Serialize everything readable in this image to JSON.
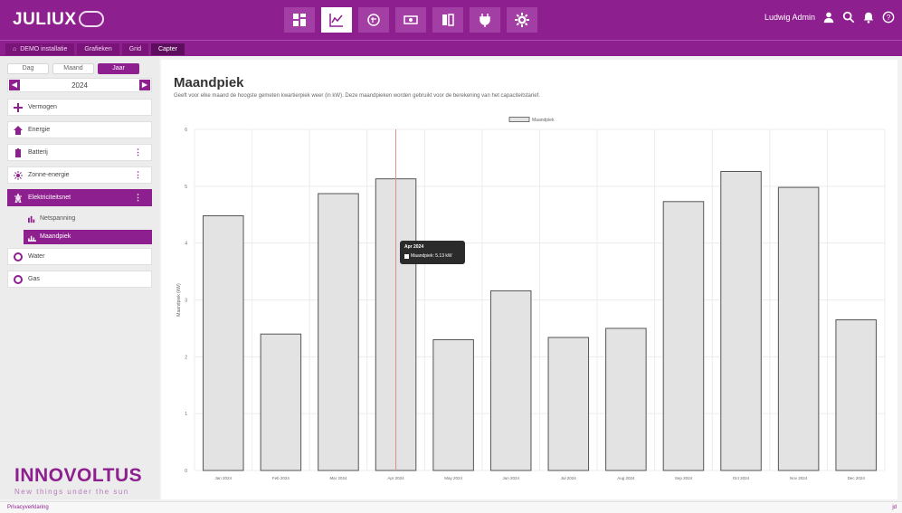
{
  "app": {
    "name": "JULIUX"
  },
  "nav": [
    {
      "name": "dashboard",
      "icon": "dashboard-icon",
      "active": false
    },
    {
      "name": "grafieken",
      "icon": "line-chart-icon",
      "active": true
    },
    {
      "name": "brain",
      "icon": "brain-icon",
      "active": false
    },
    {
      "name": "money",
      "icon": "money-icon",
      "active": false
    },
    {
      "name": "battery",
      "icon": "battery-icon",
      "active": false
    },
    {
      "name": "plug",
      "icon": "plug-icon",
      "active": false
    },
    {
      "name": "settings",
      "icon": "gear-icon",
      "active": false
    }
  ],
  "user": {
    "name": "Ludwig Admin"
  },
  "breadcrumbs": [
    "DEMO installatie",
    "Grafieken",
    "Grid",
    "Capter"
  ],
  "sidebar": {
    "period": {
      "day": "Dag",
      "month": "Maand",
      "year": "Jaar"
    },
    "year_value": "2024",
    "items": [
      {
        "label": "Vermogen",
        "icon": "power-icon",
        "dots": false
      },
      {
        "label": "Energie",
        "icon": "home-icon",
        "dots": false
      },
      {
        "label": "Batterij",
        "icon": "battery-icon",
        "dots": true
      },
      {
        "label": "Zonne-energie",
        "icon": "sun-icon",
        "dots": true
      },
      {
        "label": "Elektriciteitsnet",
        "icon": "grid-tower-icon",
        "dots": true
      }
    ],
    "subitems": [
      {
        "label": "Netspanning",
        "icon": "voltage-icon"
      },
      {
        "label": "Maandpiek",
        "icon": "peak-icon"
      }
    ],
    "items2": [
      {
        "label": "Water",
        "icon": "water-icon"
      },
      {
        "label": "Gas",
        "icon": "gas-icon"
      }
    ],
    "brand": {
      "name": "INNOVOLTUS",
      "tagline": "New things under the sun"
    }
  },
  "main": {
    "title": "Maandpiek",
    "description": "Geeft voor elke maand de hoogste gemeten kwartierpiek weer (in kW). Deze maandpieken worden gebruikt voor de berekening van het capaciteitstarief."
  },
  "chart_data": {
    "type": "bar",
    "categories": [
      "Jan 2024",
      "Feb 2024",
      "Mar 2024",
      "Apr 2024",
      "May 2024",
      "Jun 2024",
      "Jul 2024",
      "Aug 2024",
      "Sep 2024",
      "Oct 2024",
      "Nov 2024",
      "Dec 2024"
    ],
    "series": [
      {
        "name": "Maandpiek",
        "values": [
          4.48,
          2.4,
          4.87,
          5.13,
          2.3,
          3.16,
          2.34,
          2.5,
          4.73,
          5.26,
          4.98,
          2.65
        ]
      }
    ],
    "ylabel": "Maandpiek (kW)",
    "ylim": [
      0,
      6
    ],
    "yticks": [
      "0",
      "1",
      "2",
      "3",
      "4",
      "5",
      "6"
    ],
    "legend": "top-center",
    "grid": true,
    "highlight_category": "Apr 2024",
    "tooltip": {
      "title": "Apr 2024",
      "text": "Maandpiek: 5.13 kW"
    },
    "colors": {
      "bar_fill": "#e3e3e3",
      "bar_stroke": "#555555",
      "highlight_line": "#e88b86"
    }
  },
  "footer": {
    "left": "Privacyverklaring",
    "right": "jd"
  }
}
